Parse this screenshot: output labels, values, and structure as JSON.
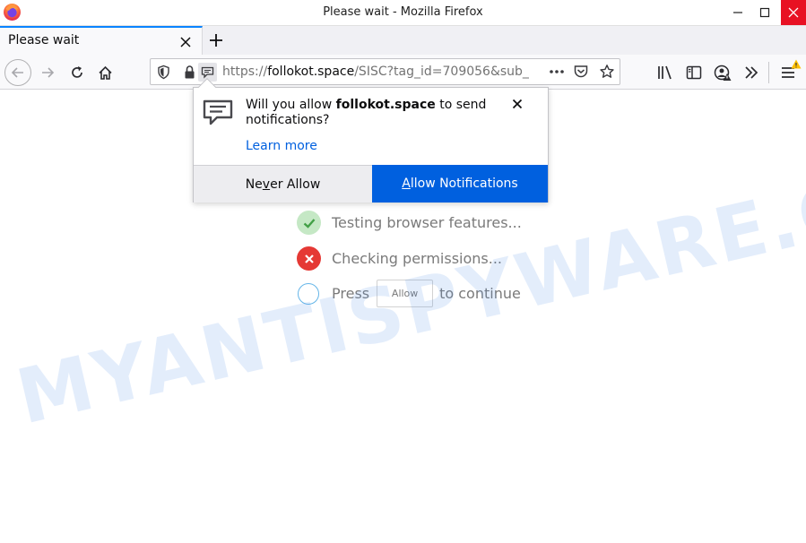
{
  "window": {
    "title": "Please wait - Mozilla Firefox"
  },
  "tab": {
    "title": "Please wait"
  },
  "urlbar": {
    "protocol": "https://",
    "host": "follokot.space",
    "path": "/SISC?tag_id=709056&sub_"
  },
  "popup": {
    "message_prefix": "Will you allow ",
    "site": "follokot.space",
    "message_suffix": " to send notifications?",
    "learn_more": "Learn more",
    "never_allow_pre": "Ne",
    "never_allow_key": "v",
    "never_allow_post": "er Allow",
    "allow_key": "A",
    "allow_post": "llow Notifications"
  },
  "page": {
    "checks": [
      {
        "text": "Testing browser features...",
        "status": "success"
      },
      {
        "text": "Checking permissions...",
        "status": "error"
      }
    ],
    "press_text": "Press",
    "allow_button": "Allow",
    "continue_text": "to continue"
  },
  "watermark": "MYANTISPYWARE.COM",
  "colors": {
    "accent": "#0060df",
    "tab_highlight": "#0a84ff",
    "close_button": "#e81123",
    "success": "#4caf50",
    "error": "#e53935"
  },
  "icons": {
    "browser": "firefox-logo",
    "back": "arrow-left",
    "forward": "arrow-right",
    "reload": "reload",
    "home": "home",
    "tracking": "shield",
    "secure": "lock",
    "permission": "speech-bubble",
    "page_actions": "ellipsis",
    "pocket": "pocket",
    "bookmark": "star",
    "library": "library",
    "sidebar": "sidebar",
    "account": "account-warning",
    "overflow": "double-chevron",
    "menu": "hamburger"
  }
}
